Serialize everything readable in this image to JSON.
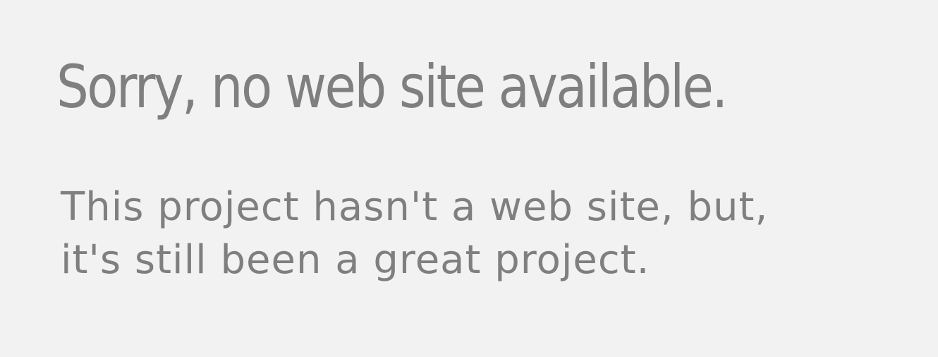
{
  "headline": "Sorry, no web site available.",
  "message": {
    "line1": "This project hasn't a web site, but,",
    "line2": "it's still been a great project."
  },
  "colors": {
    "background": "#f2f2f2",
    "text": "#7f7f7f"
  }
}
